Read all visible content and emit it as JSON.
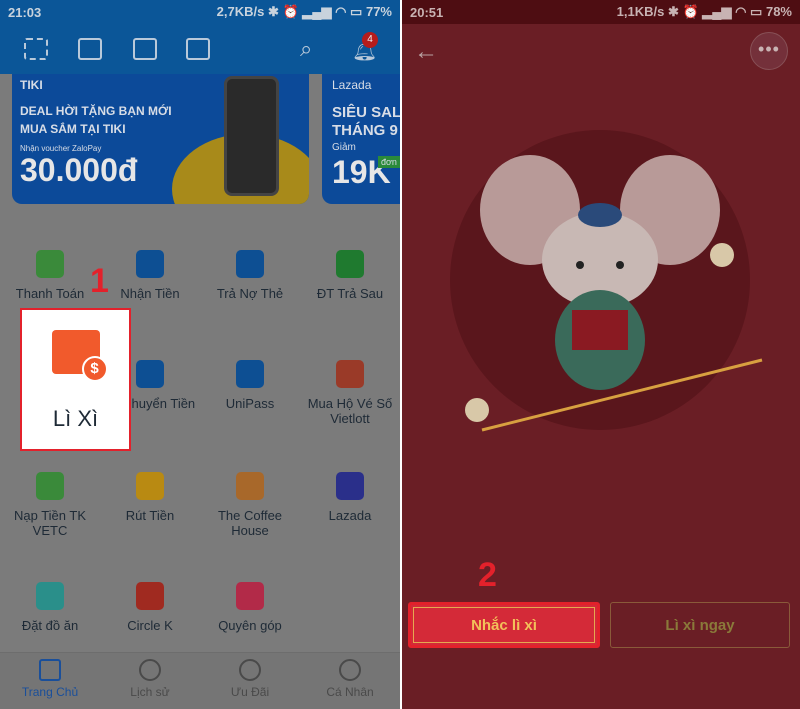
{
  "left": {
    "status": {
      "time": "21:03",
      "speed": "2,7KB/s",
      "battery": "77%"
    },
    "notification_count": "4",
    "banners": [
      {
        "brand": "TIKI",
        "line1": "DEAL HỜI TẶNG BẠN MỚI",
        "line2": "MUA SẮM TẠI TIKI",
        "caption": "Nhận voucher ZaloPay",
        "amount": "30.000đ"
      },
      {
        "brand": "Lazada",
        "line1": "SIÊU SAL",
        "line2": "THÁNG 9",
        "caption": "Giảm",
        "amount": "19K",
        "tag": "đơn h"
      }
    ],
    "services": [
      {
        "label": "Thanh Toán",
        "color": "#3a8a3a"
      },
      {
        "label": "Nhận Tiền",
        "color": "#0d4f93"
      },
      {
        "label": "Trả Nợ Thẻ",
        "color": "#0d4f93"
      },
      {
        "label": "ĐT Trả Sau",
        "color": "#1f7a2f"
      },
      {
        "label": "",
        "color": "#7b7b7b"
      },
      {
        "label": "ắc Chuyển Tiền",
        "color": "#0d4f93"
      },
      {
        "label": "UniPass",
        "color": "#0d4f93"
      },
      {
        "label": "Mua Hộ Vé Số Vietlott",
        "color": "#9a3a28"
      },
      {
        "label": "Nạp Tiền TK VETC",
        "color": "#3a8a3a"
      },
      {
        "label": "Rút Tiền",
        "color": "#b98a12"
      },
      {
        "label": "The Coffee House",
        "color": "#a8682a"
      },
      {
        "label": "Lazada",
        "color": "#2a2f8a"
      },
      {
        "label": "Đặt đồ ăn",
        "color": "#2a8f8a"
      },
      {
        "label": "Circle K",
        "color": "#a02a20"
      },
      {
        "label": "Quyên góp",
        "color": "#b22a48"
      },
      {
        "label": "",
        "color": "#7b7b7b"
      }
    ],
    "highlight": {
      "label": "Lì Xì",
      "step": "1"
    },
    "nav": [
      {
        "label": "Trang Chủ",
        "active": true
      },
      {
        "label": "Lịch sử"
      },
      {
        "label": "Ưu Đãi"
      },
      {
        "label": "Cá Nhân"
      }
    ]
  },
  "right": {
    "status": {
      "time": "20:51",
      "speed": "1,1KB/s",
      "battery": "78%"
    },
    "step": "2",
    "remind_button": "Nhắc lì xì",
    "give_button": "Lì xì ngay"
  },
  "colors": {
    "accent_red": "#e3212b",
    "gold": "#f2c15a",
    "zalo_blue": "#0b5698"
  }
}
